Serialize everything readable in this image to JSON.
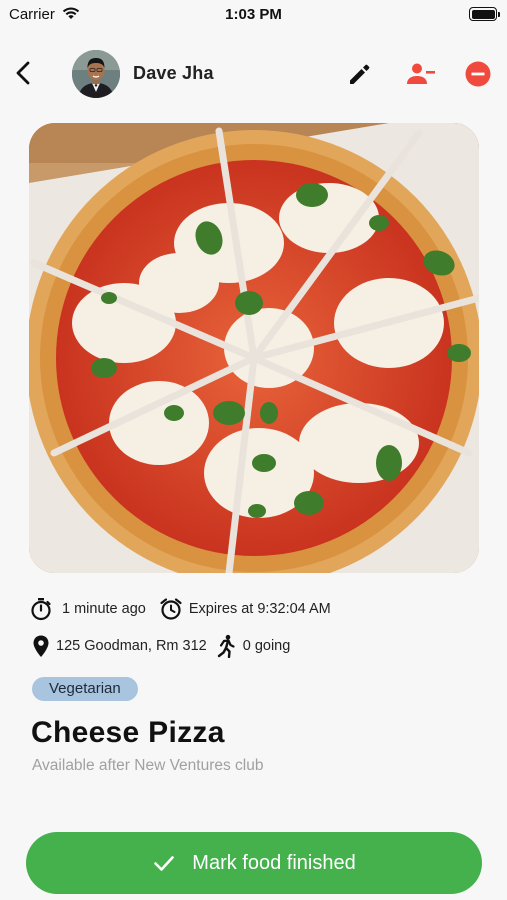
{
  "status_bar": {
    "carrier": "Carrier",
    "time": "1:03 PM"
  },
  "header": {
    "poster_name": "Dave Jha",
    "icons": [
      "back-chevron-icon",
      "edit-pencil-icon",
      "remove-person-icon",
      "delete-circle-icon"
    ],
    "danger_color": "#ef4a3d"
  },
  "post": {
    "posted_ago": "1 minute ago",
    "expires": "Expires at 9:32:04 AM",
    "location": "125 Goodman, Rm 312",
    "going_count": "0 going",
    "tag": "Vegetarian",
    "title": "Cheese Pizza",
    "subtitle": "Available after New Ventures club"
  },
  "actions": {
    "finish_label": "Mark food finished",
    "accent_color": "#44b14c"
  }
}
